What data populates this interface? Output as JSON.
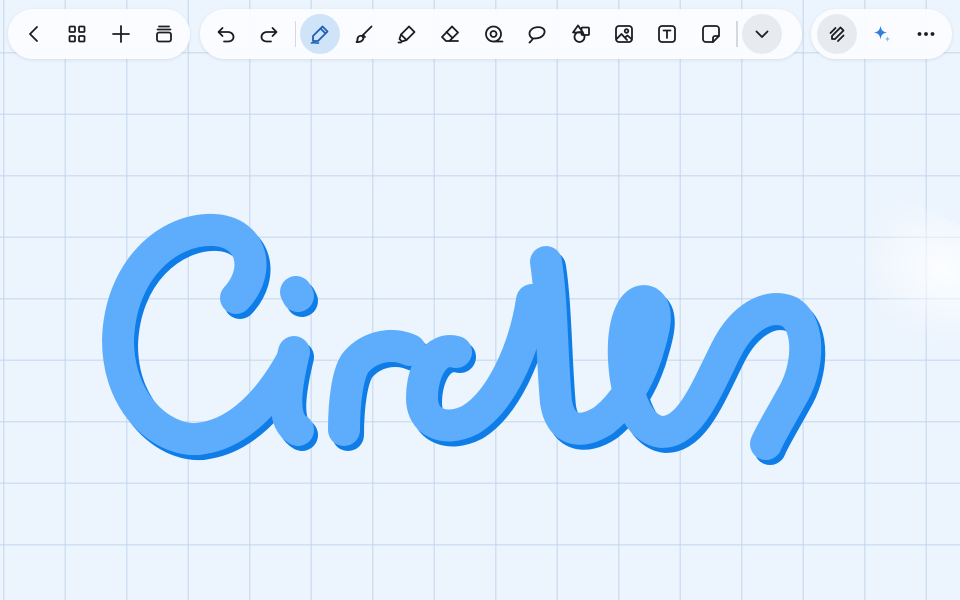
{
  "toolbar": {
    "left": [
      {
        "name": "back-icon"
      },
      {
        "name": "grid-icon"
      },
      {
        "name": "plus-icon"
      },
      {
        "name": "pages-icon"
      }
    ],
    "middle": [
      {
        "name": "undo-icon"
      },
      {
        "name": "redo-icon"
      },
      {
        "name": "pen-icon",
        "active": true
      },
      {
        "name": "brush-icon"
      },
      {
        "name": "highlighter-icon"
      },
      {
        "name": "eraser-icon"
      },
      {
        "name": "tape-icon"
      },
      {
        "name": "lasso-icon"
      },
      {
        "name": "shapes-icon"
      },
      {
        "name": "image-icon"
      },
      {
        "name": "text-box-icon"
      },
      {
        "name": "sticky-note-icon"
      },
      {
        "name": "chevron-down-icon"
      }
    ],
    "right": [
      {
        "name": "pen-settings-icon"
      },
      {
        "name": "sparkle-icon"
      },
      {
        "name": "more-icon"
      }
    ]
  },
  "canvas": {
    "handwriting": "Circles",
    "ink_color": "#5eadfc",
    "ink_shadow_color": "#0e7de8",
    "grid_color": "#bad0ea",
    "background_color": "#ecf4fd",
    "accent_color": "#2f7ee0"
  }
}
